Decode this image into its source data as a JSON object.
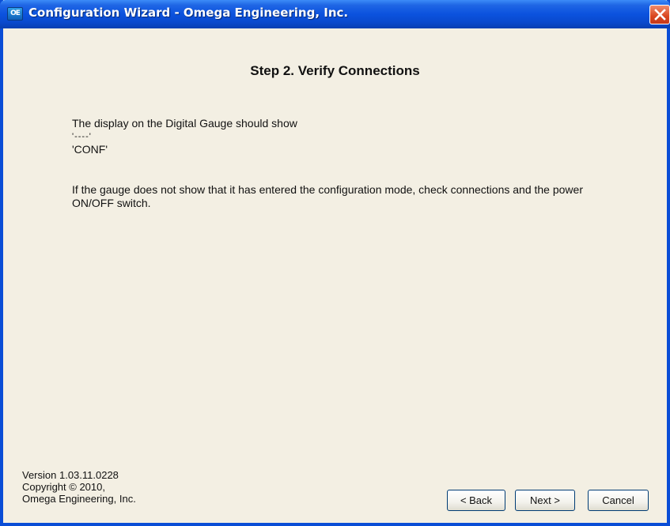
{
  "window": {
    "title": "Configuration Wizard - Omega Engineering, Inc.",
    "icon_text": "OE",
    "icon": "omega-app-icon",
    "close_icon": "close-icon"
  },
  "wizard": {
    "step_title": "Step 2.  Verify Connections",
    "line1": "The display on the Digital Gauge should show",
    "line2": "'----'",
    "line3": "'CONF'",
    "paragraph": "If the gauge does not show that it has entered the configuration mode, check connections and the power ON/OFF switch."
  },
  "footer": {
    "version": "Version 1.03.11.0228",
    "copyright": "Copyright © 2010,",
    "company": "Omega Engineering, Inc."
  },
  "buttons": {
    "back": "< Back",
    "next": "Next >",
    "cancel": "Cancel"
  },
  "colors": {
    "titlebar": "#0b52de",
    "background": "#f3efe3",
    "close": "#d9461f"
  }
}
